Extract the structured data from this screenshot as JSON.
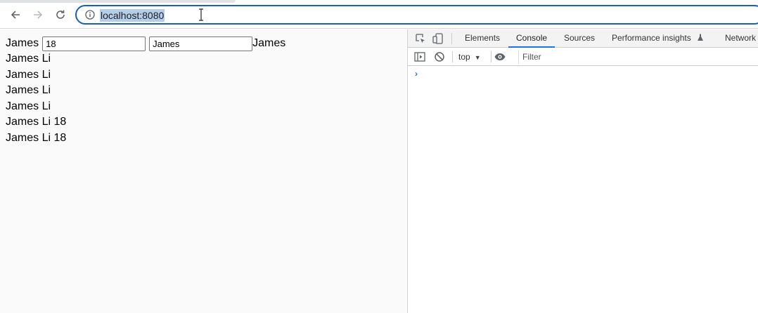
{
  "browser": {
    "url": "localhost:8080"
  },
  "page": {
    "label_left": "James",
    "age_input_value": "18",
    "name_input_value": "James",
    "label_right": "James",
    "lines": [
      "James Li",
      "James Li",
      "James Li",
      "James Li",
      "James Li 18",
      "James Li 18"
    ]
  },
  "devtools": {
    "tabs": [
      {
        "label": "Elements",
        "active": false
      },
      {
        "label": "Console",
        "active": true
      },
      {
        "label": "Sources",
        "active": false
      },
      {
        "label": "Performance insights",
        "active": false
      },
      {
        "label": "Network",
        "active": false
      }
    ],
    "context": "top",
    "filter_placeholder": "Filter",
    "prompt_symbol": "›"
  },
  "colors": {
    "accent": "#1a73e8",
    "omnibox_border": "#1a5fb4",
    "url_selection": "#b4cdea"
  },
  "icons": [
    "back-arrow-icon",
    "forward-arrow-icon",
    "reload-icon",
    "info-icon",
    "text-cursor-icon",
    "inspect-element-icon",
    "device-toolbar-icon",
    "flask-icon",
    "sidebar-toggle-icon",
    "clear-console-icon",
    "eye-icon"
  ]
}
